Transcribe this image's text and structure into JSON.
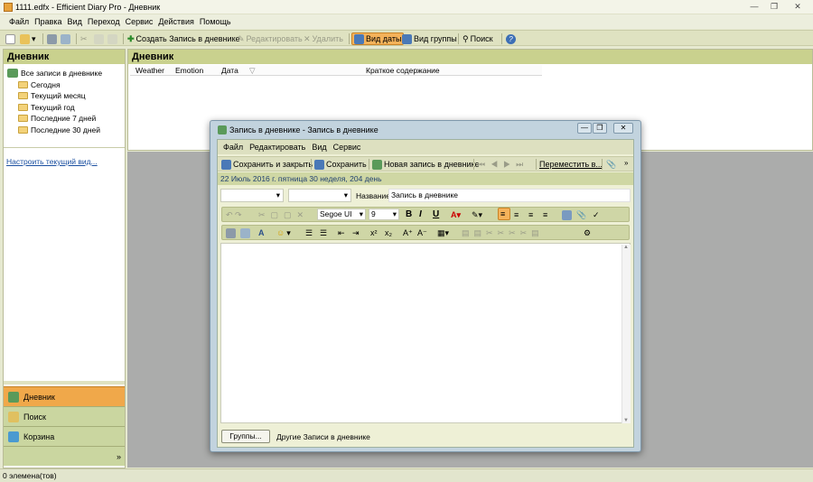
{
  "window": {
    "title": "1111.edfx - Efficient Diary Pro - Дневник"
  },
  "menu": [
    "Файл",
    "Правка",
    "Вид",
    "Переход",
    "Сервис",
    "Действия",
    "Помощь"
  ],
  "toolbar": {
    "create": "Создать Запись в дневнике",
    "edit": "Редактировать",
    "delete": "Удалить",
    "view_date": "Вид даты",
    "view_group": "Вид группы",
    "search": "Поиск"
  },
  "left": {
    "title": "Дневник",
    "root": "Все записи в дневнике",
    "items": [
      "Сегодня",
      "Текущий месяц",
      "Текущий год",
      "Последние 7 дней",
      "Последние 30 дней"
    ],
    "customize": "Настроить текущий вид...",
    "nav": [
      "Дневник",
      "Поиск",
      "Корзина"
    ]
  },
  "right": {
    "title": "Дневник",
    "columns": [
      "Weather",
      "Emotion",
      "Дата",
      "Краткое содержание"
    ]
  },
  "status": "0 элемена(тов)",
  "dialog": {
    "title": "Запись в дневнике - Запись в дневнике",
    "menu": [
      "Файл",
      "Редактировать",
      "Вид",
      "Сервис"
    ],
    "save_close": "Сохранить и закрыть",
    "save": "Сохранить",
    "new_entry": "Новая запись в дневнике",
    "move": "Переместить в...",
    "date_info": "22 Июль 2016 г. пятница     30 неделя, 204 день",
    "name_label": "Название",
    "name_value": "Запись в дневнике",
    "font": "Segoe UI",
    "size": "9",
    "groups_btn": "Группы...",
    "other": "Другие Записи в дневнике"
  },
  "colors": {
    "accent": "#f0a84a",
    "header": "#c9d18e",
    "toolbar": "#dfe2c1"
  }
}
